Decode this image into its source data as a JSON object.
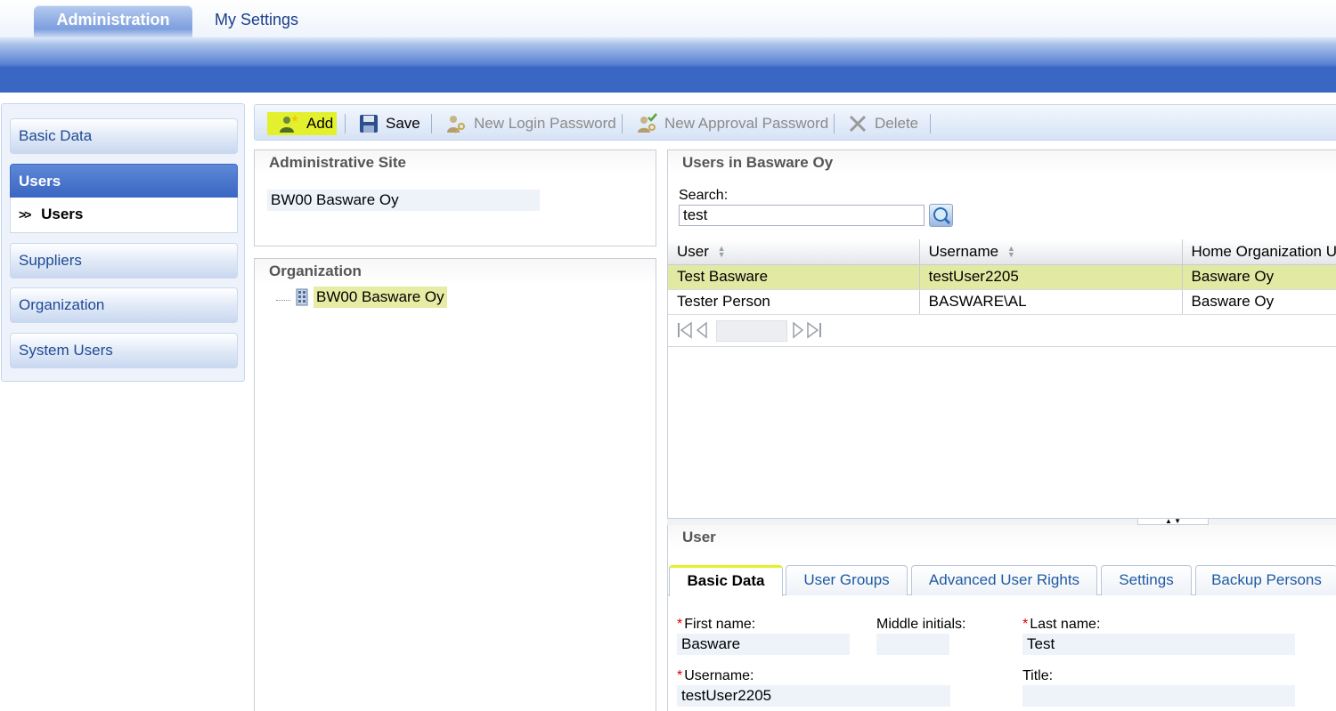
{
  "top_tabs": [
    {
      "label": "Administration",
      "active": true
    },
    {
      "label": "My Settings",
      "active": false
    }
  ],
  "sidebar": {
    "items": [
      {
        "label": "Basic Data"
      },
      {
        "label": "Users",
        "active": true,
        "sub": "Users"
      },
      {
        "label": "Suppliers"
      },
      {
        "label": "Organization"
      },
      {
        "label": "System Users"
      }
    ]
  },
  "toolbar": {
    "add": "Add",
    "save": "Save",
    "new_login_password": "New Login Password",
    "new_approval_password": "New Approval Password",
    "delete": "Delete"
  },
  "admin_site": {
    "title": "Administrative Site",
    "value": "BW00 Basware Oy"
  },
  "organization": {
    "title": "Organization",
    "node": "BW00 Basware Oy"
  },
  "users_panel": {
    "title": "Users in Basware Oy",
    "search_label": "Search:",
    "search_value": "test",
    "columns": [
      "User",
      "Username",
      "Home Organization U"
    ],
    "rows": [
      [
        "Test Basware",
        "testUser2205",
        "Basware Oy"
      ],
      [
        "Tester Person",
        "BASWARE\\AL",
        "Basware Oy"
      ]
    ],
    "selected_row": 0
  },
  "user_panel": {
    "title": "User",
    "tabs": [
      "Basic Data",
      "User Groups",
      "Advanced User Rights",
      "Settings",
      "Backup Persons"
    ],
    "active_tab": 0,
    "fields": {
      "first_name_label": "First name:",
      "first_name": "Basware",
      "middle_initials_label": "Middle initials:",
      "middle_initials": "",
      "last_name_label": "Last name:",
      "last_name": "Test",
      "username_label": "Username:",
      "username": "testUser2205",
      "title_label": "Title:",
      "title": ""
    }
  },
  "colors": {
    "accent_blue": "#3a66c4",
    "highlight_yellow": "#e3f02d",
    "selected_row": "#e2e9a2"
  }
}
